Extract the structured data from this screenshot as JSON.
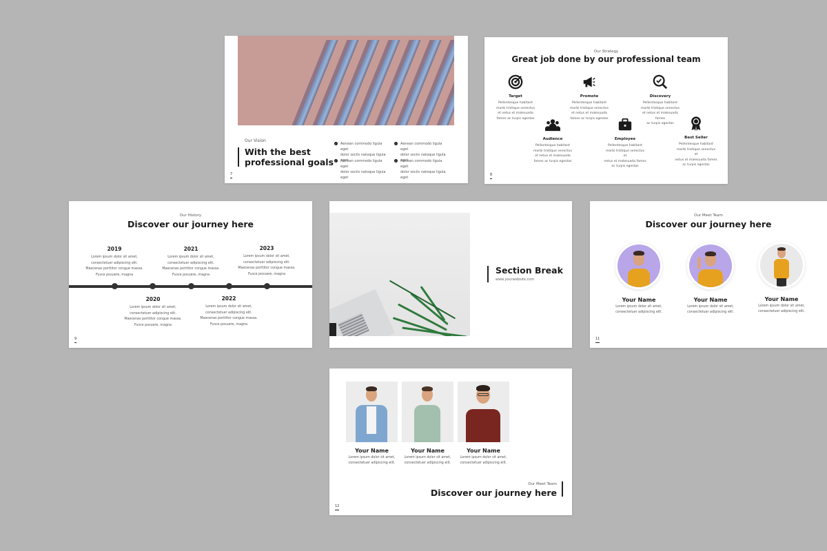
{
  "slides": {
    "vision": {
      "page": "7",
      "eyebrow": "Our Vision",
      "title_line1": "With the best",
      "title_line2": "professional goals",
      "bullets": [
        {
          "line1": "Aenean commodo ligula eget",
          "line2": "dolor sociis natoque ligula eget"
        },
        {
          "line1": "Aenean commodo ligula eget",
          "line2": "dolor sociis natoque ligula eget"
        },
        {
          "line1": "Aenean commodo ligula eget",
          "line2": "dolor sociis natoque ligula eget"
        },
        {
          "line1": "Aenean commodo ligula eget",
          "line2": "dolor sociis natoque ligula eget"
        }
      ]
    },
    "strategy": {
      "page": "8",
      "eyebrow": "Our Strategy",
      "title": "Great job done by our professional team",
      "services": [
        {
          "label": "Target",
          "icon": "target-icon",
          "l1": "Pellentesque habitant",
          "l2": "morbi tristique senectus",
          "l3": "et netus et malesuada",
          "l4": "fames ac turpis egestas"
        },
        {
          "label": "Promote",
          "icon": "megaphone-icon",
          "l1": "Pellentesque habitant",
          "l2": "morbi tristique senectus",
          "l3": "et netus et malesuada",
          "l4": "fames ac turpis egestas"
        },
        {
          "label": "Discovery",
          "icon": "magnifier-check-icon",
          "l1": "Pellentesque habitant",
          "l2": "morbi tristique senectus",
          "l3": "et netus et malesuada fames",
          "l4": "ac turpis egestas"
        },
        {
          "label": "Audience",
          "icon": "audience-icon",
          "l1": "Pellentesque habitant",
          "l2": "morbi tristique senectus",
          "l3": "et netus et malesuada",
          "l4": "fames ac turpis egestas"
        },
        {
          "label": "Employee",
          "icon": "briefcase-icon",
          "l1": "Pellentesque habitant",
          "l2": "morbi tristique senectus et",
          "l3": "netus et malesuada fames",
          "l4": "ac turpis egestas"
        },
        {
          "label": "Best Seller",
          "icon": "award-badge-icon",
          "l1": "Pellentesque habitant",
          "l2": "morbi tristique senectus et",
          "l3": "netus et malesuada fames",
          "l4": "ac turpis egestas"
        }
      ]
    },
    "history": {
      "page": "9",
      "eyebrow": "Our History",
      "title": "Discover our journey here",
      "events": [
        {
          "year": "2019",
          "l1": "Lorem ipsum dolor sit amet,",
          "l2": "consectetuer adipiscing elit.",
          "l3": "Maecenas porttitor congue massa.",
          "l4": "Fusce posuere, magna"
        },
        {
          "year": "2021",
          "l1": "Lorem ipsum dolor sit amet,",
          "l2": "consectetuer adipiscing elit.",
          "l3": "Maecenas porttitor congue massa.",
          "l4": "Fusce posuere, magna"
        },
        {
          "year": "2023",
          "l1": "Lorem ipsum dolor sit amet,",
          "l2": "consectetuer adipiscing elit.",
          "l3": "Maecenas porttitor congue massa.",
          "l4": "Fusce posuere, magna"
        },
        {
          "year": "2020",
          "l1": "Lorem ipsum dolor sit amet,",
          "l2": "consectetuer adipiscing elit.",
          "l3": "Maecenas porttitor congue massa.",
          "l4": "Fusce posuere, magna"
        },
        {
          "year": "2022",
          "l1": "Lorem ipsum dolor sit amet,",
          "l2": "consectetuer adipiscing elit.",
          "l3": "Maecenas porttitor congue massa.",
          "l4": "Fusce posuere, magna"
        }
      ]
    },
    "section_break": {
      "title": "Section Break",
      "website": "www.yourwebsite.com"
    },
    "meet_team": {
      "page": "11",
      "eyebrow": "Our Meet Team",
      "title": "Discover our journey here",
      "members": [
        {
          "name": "Your Name",
          "l1": "Lorem ipsum dolor sit amet,",
          "l2": "consectetuer adipiscing elit."
        },
        {
          "name": "Your Name",
          "l1": "Lorem ipsum dolor sit amet,",
          "l2": "consectetuer adipiscing elit."
        },
        {
          "name": "Your Name",
          "l1": "Lorem ipsum dolor sit amet,",
          "l2": "consectetuer adipiscing elit."
        }
      ]
    },
    "team_grid": {
      "page": "12",
      "eyebrow": "Our Meet Team",
      "title": "Discover our journey here",
      "members": [
        {
          "name": "Your Name",
          "l1": "Lorem ipsum dolor sit amet,",
          "l2": "consectetuer adipiscing elit."
        },
        {
          "name": "Your Name",
          "l1": "Lorem ipsum dolor sit amet,",
          "l2": "consectetuer adipiscing elit."
        },
        {
          "name": "Your Name",
          "l1": "Lorem ipsum dolor sit amet,",
          "l2": "consectetuer adipiscing elit."
        }
      ]
    }
  },
  "colors": {
    "background": "#b5b5b5",
    "slide": "#ffffff",
    "accent_dark": "#1b1b1b",
    "pink_photo": "#c79c97",
    "blue_fins": "#8fa9d4",
    "avatar_purple": "#b8a6e8",
    "sweater_yellow": "#e6a21f"
  }
}
